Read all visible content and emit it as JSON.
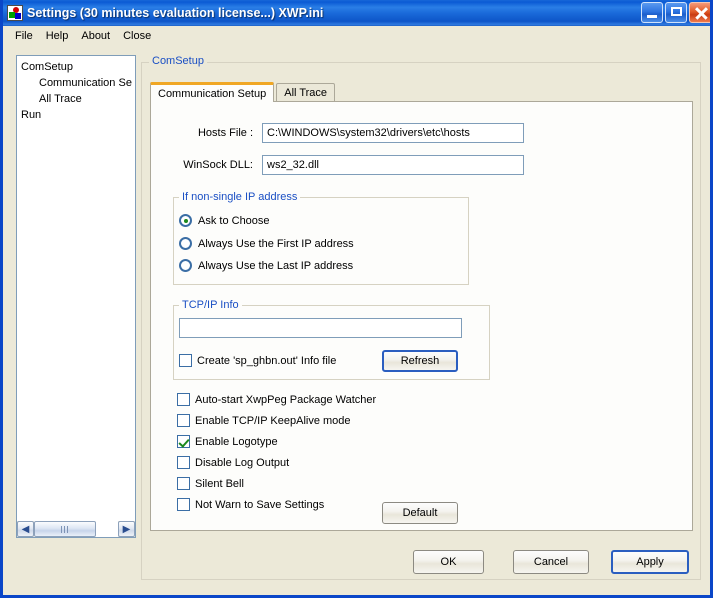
{
  "window": {
    "title": "Settings (30 minutes evaluation license...) XWP.ini",
    "icon": "app-logo-icon",
    "minimize_label": "Minimize",
    "maximize_label": "Maximize",
    "close_label": "Close"
  },
  "menubar": {
    "items": [
      {
        "label": "File"
      },
      {
        "label": "Help"
      },
      {
        "label": "About"
      },
      {
        "label": "Close"
      }
    ]
  },
  "tree": {
    "items": [
      {
        "label": "ComSetup",
        "indent": false
      },
      {
        "label": "Communication Se",
        "indent": true
      },
      {
        "label": "All Trace",
        "indent": true
      },
      {
        "label": "Run",
        "indent": false
      }
    ],
    "scroll_left_icon": "chevron-left-icon",
    "scroll_right_icon": "chevron-right-icon"
  },
  "main": {
    "group_label": "ComSetup",
    "tabs": [
      {
        "label": "Communication Setup",
        "active": true
      },
      {
        "label": "All Trace",
        "active": false
      }
    ],
    "fields": {
      "hosts_file_label": "Hosts File :",
      "hosts_file_value": "C:\\WINDOWS\\system32\\drivers\\etc\\hosts",
      "winsock_dll_label": "WinSock DLL:",
      "winsock_dll_value": "ws2_32.dll"
    },
    "ip_group": {
      "label": "If non-single IP address",
      "options": [
        {
          "label": "Ask to Choose",
          "checked": true
        },
        {
          "label": "Always Use the First IP address",
          "checked": false
        },
        {
          "label": "Always Use the Last IP address",
          "checked": false
        }
      ]
    },
    "tcpip_group": {
      "label": "TCP/IP Info",
      "info_value": "",
      "info_placeholder": "",
      "create_file_label": "Create 'sp_ghbn.out' Info file",
      "create_file_checked": false,
      "refresh_label": "Refresh"
    },
    "options": [
      {
        "label": "Auto-start XwpPeg Package Watcher",
        "checked": false
      },
      {
        "label": "Enable TCP/IP KeepAlive mode",
        "checked": false
      },
      {
        "label": "Enable Logotype",
        "checked": true
      },
      {
        "label": "Disable Log Output",
        "checked": false
      },
      {
        "label": "Silent Bell",
        "checked": false
      },
      {
        "label": "Not Warn to Save Settings",
        "checked": false
      }
    ],
    "default_label": "Default"
  },
  "footer": {
    "ok_label": "OK",
    "cancel_label": "Cancel",
    "apply_label": "Apply"
  },
  "colors": {
    "titlebar_blue": "#0a5ad4",
    "window_border": "#0a46c8",
    "face": "#ece9d8",
    "group_label_blue": "#1a4fc4",
    "active_tab_accent": "#f0a724",
    "check_green": "#1d8a1d",
    "default_button_border": "#2b5ec0"
  }
}
